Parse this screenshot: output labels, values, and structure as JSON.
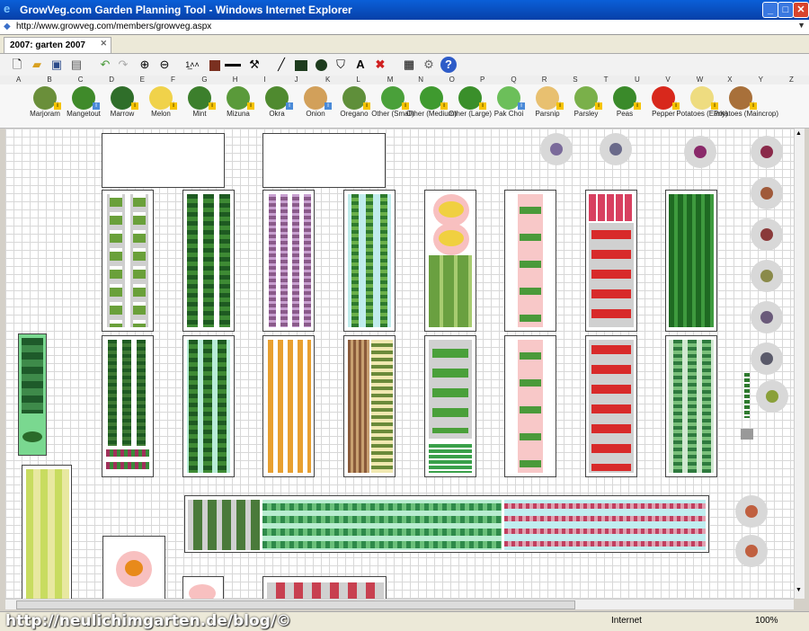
{
  "window": {
    "title": "GrowVeg.com Garden Planning Tool - Windows Internet Explorer",
    "minimize": "_",
    "maximize": "□",
    "close": "✕"
  },
  "address": {
    "url": "http://www.growveg.com/members/growveg.aspx"
  },
  "tab": {
    "label": "2007: garten 2007",
    "close": "✕"
  },
  "toolbar": {
    "icons": [
      "new-icon",
      "open-icon",
      "save-icon",
      "print-icon",
      "undo-icon",
      "redo-icon",
      "zoom-in-icon",
      "zoom-out-icon",
      "measure-icon",
      "fill-color-icon",
      "line-width-icon",
      "hammer-icon",
      "line-tool-icon",
      "rectangle-tool-icon",
      "circle-tool-icon",
      "paint-bucket-icon",
      "text-tool-icon",
      "delete-icon",
      "list-icon",
      "settings-icon",
      "help-icon"
    ],
    "text_label": "A",
    "delete_label": "✖",
    "help_label": "?"
  },
  "ruler_letters": [
    "A",
    "B",
    "C",
    "D",
    "E",
    "F",
    "G",
    "H",
    "I",
    "J",
    "K",
    "L",
    "M",
    "N",
    "O",
    "P",
    "Q",
    "R",
    "S",
    "T",
    "U",
    "V",
    "W",
    "X",
    "Y",
    "Z"
  ],
  "plants": [
    {
      "name": "Marjoram",
      "color": "#6a8f3a",
      "info": "yellow"
    },
    {
      "name": "Mangetout",
      "color": "#3f8a2a",
      "info": "blue"
    },
    {
      "name": "Marrow",
      "color": "#2f6e2a",
      "info": "yellow"
    },
    {
      "name": "Melon",
      "color": "#f0d24a",
      "info": "yellow"
    },
    {
      "name": "Mint",
      "color": "#3c7f2c",
      "info": "yellow"
    },
    {
      "name": "Mizuna",
      "color": "#5a9a3a",
      "info": "yellow"
    },
    {
      "name": "Okra",
      "color": "#4f8a2f",
      "info": "blue"
    },
    {
      "name": "Onion",
      "color": "#d2a05a",
      "info": "blue"
    },
    {
      "name": "Oregano",
      "color": "#5f8f3a",
      "info": "yellow"
    },
    {
      "name": "Other (Small)",
      "color": "#4aa03a",
      "info": "yellow"
    },
    {
      "name": "Other (Medium)",
      "color": "#3f9a2f",
      "info": "yellow"
    },
    {
      "name": "Other (Large)",
      "color": "#3a8f2a",
      "info": "yellow"
    },
    {
      "name": "Pak Choi",
      "color": "#6cbf5a",
      "info": "blue"
    },
    {
      "name": "Parsnip",
      "color": "#e8c070",
      "info": "yellow"
    },
    {
      "name": "Parsley",
      "color": "#7ab04a",
      "info": "yellow"
    },
    {
      "name": "Peas",
      "color": "#3a8a2a",
      "info": "yellow"
    },
    {
      "name": "Pepper",
      "color": "#d8281c",
      "info": "yellow"
    },
    {
      "name": "Potatoes (Early)",
      "color": "#eedc80",
      "info": "yellow"
    },
    {
      "name": "Potatoes (Maincrop)",
      "color": "#a8703a",
      "info": "yellow"
    }
  ],
  "status": {
    "zone": "Internet",
    "zoom": "100%"
  },
  "watermark": "http://neulichimgarten.de/blog/©"
}
